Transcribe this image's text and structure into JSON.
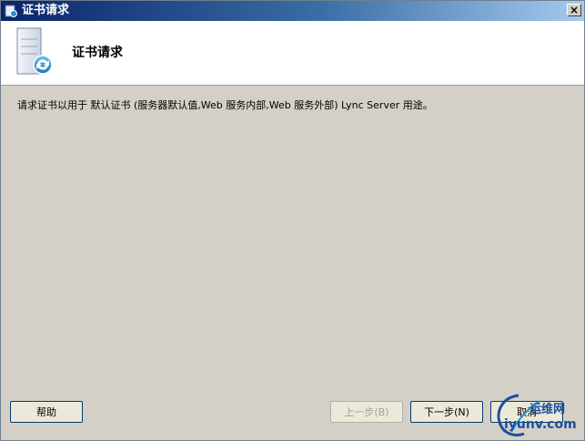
{
  "window": {
    "title": "证书请求",
    "close_glyph": "×"
  },
  "header": {
    "title": "证书请求",
    "icon": "certificate-server-icon"
  },
  "body": {
    "description": "请求证书以用于 默认证书 (服务器默认值,Web 服务内部,Web 服务外部) Lync Server 用途。"
  },
  "buttons": {
    "help": "帮助",
    "prev": "上一步(B)",
    "next": "下一步(N)",
    "cancel": "取消"
  },
  "watermark": {
    "cn": "运维网",
    "url": "iyunv.com"
  },
  "colors": {
    "titlebar_start": "#0a246a",
    "dialog_bg": "#d4d0c8",
    "header_bg": "#ffffff",
    "watermark": "#1a4f9c"
  }
}
